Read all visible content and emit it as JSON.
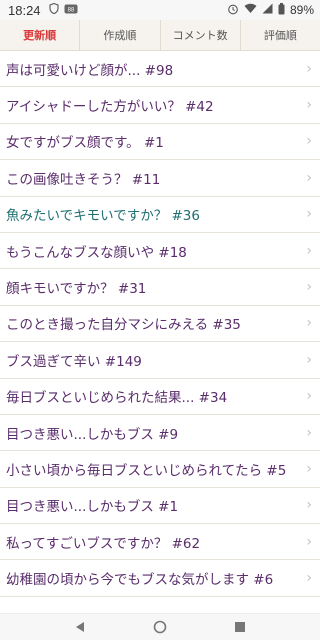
{
  "status": {
    "time": "18:24",
    "battery": "89%"
  },
  "tabs": [
    {
      "label": "更新順",
      "active": true
    },
    {
      "label": "作成順",
      "active": false
    },
    {
      "label": "コメント数",
      "active": false
    },
    {
      "label": "評価順",
      "active": false
    }
  ],
  "items": [
    {
      "title": "声は可愛いけど顔が... #98",
      "visited": false
    },
    {
      "title": "アイシャドーした方がいい？ #42",
      "visited": false
    },
    {
      "title": "女ですがブス顔です。 #1",
      "visited": false
    },
    {
      "title": "この画像吐きそう？ #11",
      "visited": false
    },
    {
      "title": "魚みたいでキモいですか？ #36",
      "visited": true
    },
    {
      "title": "もうこんなブスな顔いや #18",
      "visited": false
    },
    {
      "title": "顔キモいですか？ #31",
      "visited": false
    },
    {
      "title": "このとき撮った自分マシにみえる #35",
      "visited": false
    },
    {
      "title": "ブス過ぎて辛い #149",
      "visited": false
    },
    {
      "title": "毎日ブスといじめられた結果... #34",
      "visited": false
    },
    {
      "title": "目つき悪い...しかもブス #9",
      "visited": false
    },
    {
      "title": "小さい頃から毎日ブスといじめられてたら #5",
      "visited": false
    },
    {
      "title": "目つき悪い...しかもブス #1",
      "visited": false
    },
    {
      "title": "私ってすごいブスですか？ #62",
      "visited": false
    },
    {
      "title": "幼稚園の頃から今でもブスな気がします #6",
      "visited": false
    }
  ],
  "icons": {
    "chevron": "chevron-right-icon",
    "back": "back-icon",
    "home": "home-icon",
    "recents": "recents-icon"
  }
}
